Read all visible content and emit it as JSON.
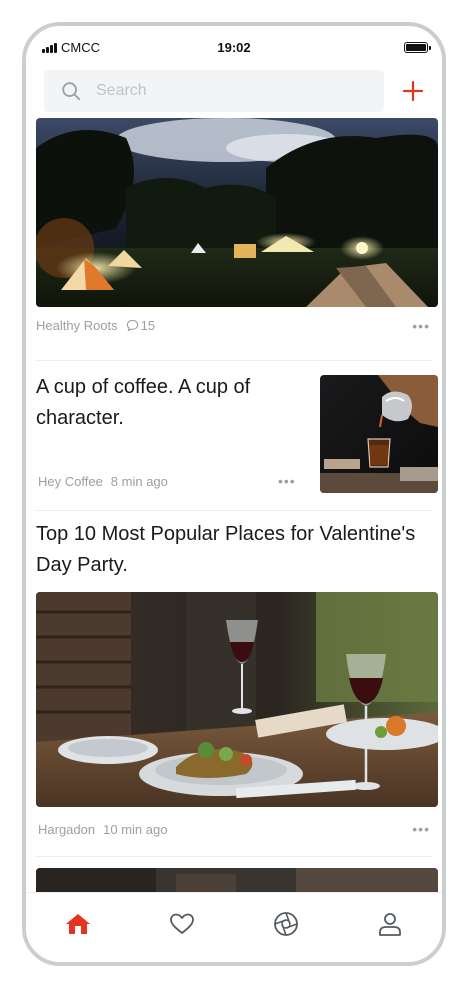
{
  "status_bar": {
    "carrier": "CMCC",
    "time": "19:02"
  },
  "search": {
    "placeholder": "Search"
  },
  "feed": [
    {
      "source": "Healthy Roots",
      "comments": "15",
      "more": "•••"
    },
    {
      "title": "A cup of coffee. A cup of character.",
      "source": "Hey Coffee",
      "time": "8 min ago",
      "more": "•••"
    },
    {
      "title": "Top 10 Most Popular Places for Valentine's Day Party.",
      "source": "Hargadon",
      "time": "10 min ago",
      "more": "•••"
    }
  ],
  "tabs": [
    {
      "name": "home",
      "active": true
    },
    {
      "name": "favorites",
      "active": false
    },
    {
      "name": "discover",
      "active": false
    },
    {
      "name": "profile",
      "active": false
    }
  ],
  "colors": {
    "accent": "#e5341d",
    "muted": "#9aa0a6",
    "text": "#1a1a1a"
  }
}
